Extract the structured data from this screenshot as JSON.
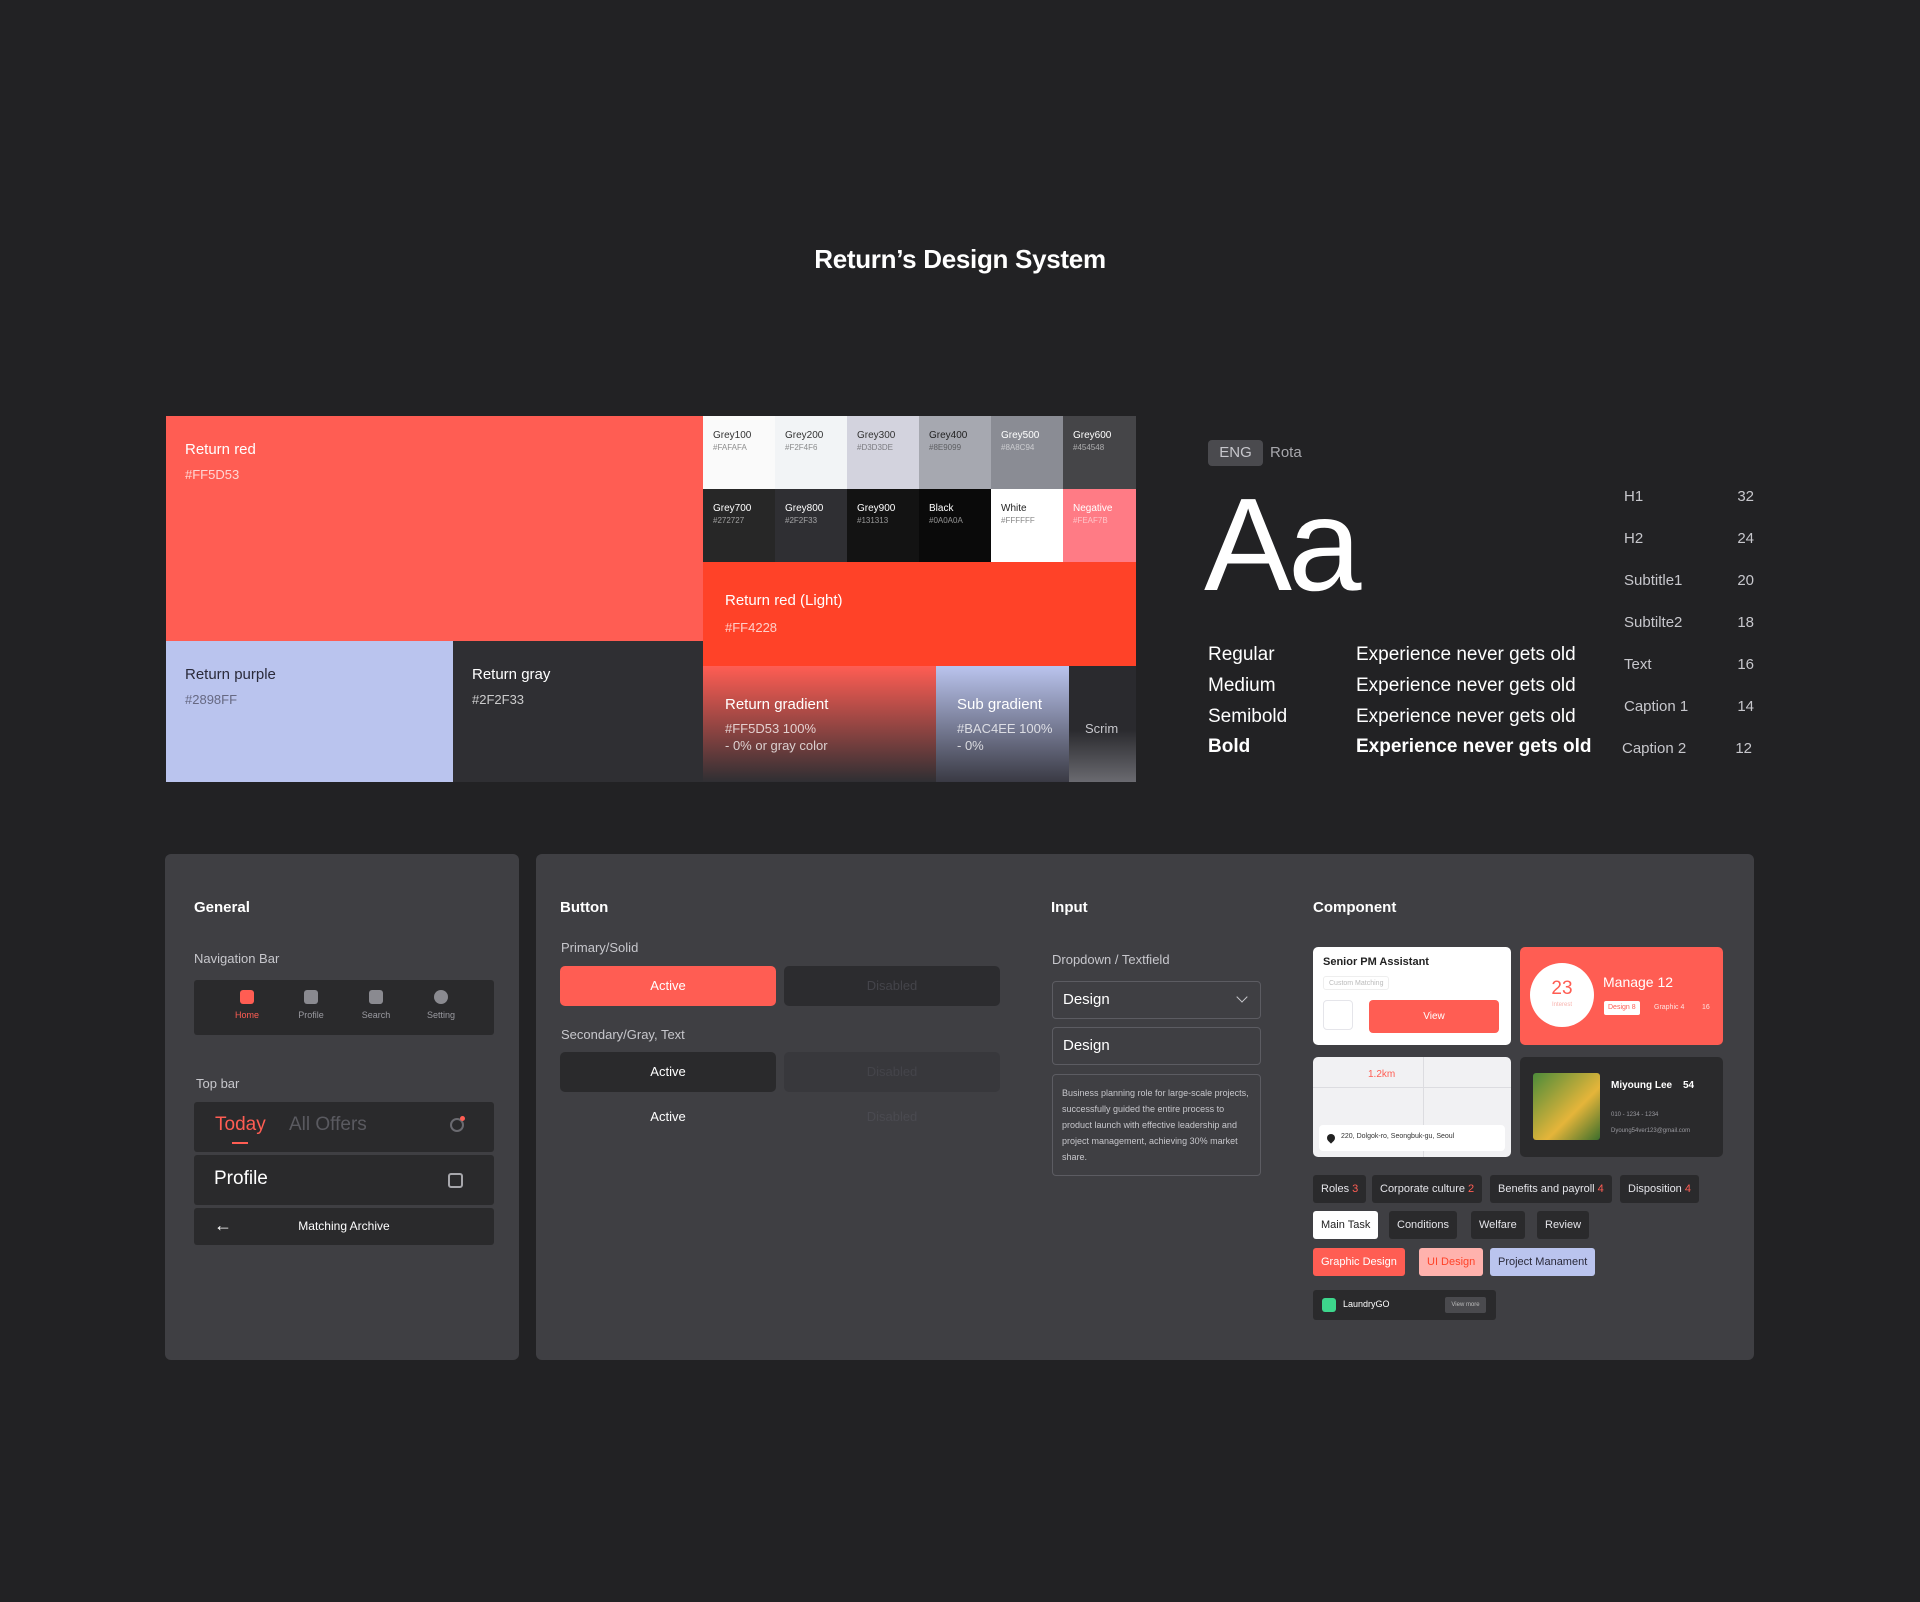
{
  "title": "Return’s Design System",
  "palette": {
    "return_red": {
      "name": "Return red",
      "hex": "#FF5D53"
    },
    "return_purple": {
      "name": "Return purple",
      "hex": "#2898FF"
    },
    "return_gray": {
      "name": "Return gray",
      "hex": "#2F2F33"
    },
    "return_red_light": {
      "name": "Return red (Light)",
      "hex": "#FF4228"
    },
    "return_gradient": {
      "name": "Return gradient",
      "hex": "#FF5D53 100%",
      "note": "- 0% or gray color"
    },
    "sub_gradient": {
      "name": "Sub gradient",
      "hex": "#BAC4EE 100%",
      "note": "- 0%"
    },
    "scrim": {
      "name": "Scrim"
    },
    "greys": [
      {
        "name": "Grey100",
        "hex": "#FAFAFA"
      },
      {
        "name": "Grey200",
        "hex": "#F2F4F6"
      },
      {
        "name": "Grey300",
        "hex": "#D3D3DE"
      },
      {
        "name": "Grey400",
        "hex": "#8E9099"
      },
      {
        "name": "Grey500",
        "hex": "#8A8C94"
      },
      {
        "name": "Grey600",
        "hex": "#454548"
      },
      {
        "name": "Grey700",
        "hex": "#272727"
      },
      {
        "name": "Grey800",
        "hex": "#2F2F33"
      },
      {
        "name": "Grey900",
        "hex": "#131313"
      },
      {
        "name": "Black",
        "hex": "#0A0A0A"
      },
      {
        "name": "White",
        "hex": "#FFFFFF"
      },
      {
        "name": "Negative",
        "hex": "#FEAF7B"
      }
    ]
  },
  "typography": {
    "lang": "ENG",
    "font": "Rota",
    "sample": "Aa",
    "weights": [
      "Regular",
      "Medium",
      "Semibold",
      "Bold"
    ],
    "sentence": "Experience never gets old",
    "scale": [
      {
        "name": "H1",
        "size": "32"
      },
      {
        "name": "H2",
        "size": "24"
      },
      {
        "name": "Subtitle1",
        "size": "20"
      },
      {
        "name": "Subtilte2",
        "size": "18"
      },
      {
        "name": "Text",
        "size": "16"
      },
      {
        "name": "Caption 1",
        "size": "14"
      },
      {
        "name": "Caption 2",
        "size": "12"
      }
    ]
  },
  "general": {
    "heading": "General",
    "nav_label": "Navigation Bar",
    "nav": [
      {
        "label": "Home",
        "icon": "home-icon"
      },
      {
        "label": "Profile",
        "icon": "profile-icon"
      },
      {
        "label": "Search",
        "icon": "search-icon"
      },
      {
        "label": "Setting",
        "icon": "gear-icon"
      }
    ],
    "topbar_label": "Top bar",
    "tab_today": "Today",
    "tab_offers": "All Offers",
    "profile": "Profile",
    "matching": "Matching Archive"
  },
  "button": {
    "heading": "Button",
    "primary_label": "Primary/Solid",
    "secondary_label": "Secondary/Gray, Text",
    "active": "Active",
    "disabled": "Disabled"
  },
  "input": {
    "heading": "Input",
    "label": "Dropdown / Textfield",
    "dropdown_value": "Design",
    "text_value": "Design",
    "textarea": "Business planning role for large-scale projects, successfully guided the entire process to product launch with effective leadership and project management, achieving 30% market share."
  },
  "component": {
    "heading": "Component",
    "job_title": "Senior PM Assistant",
    "job_tag": "Custom Matching",
    "view": "View",
    "manage_count": "23",
    "manage_sub": "Interest",
    "manage_title": "Manage 12",
    "manage_tags": [
      "Design 8",
      "Graphic 4",
      "16"
    ],
    "distance": "1.2km",
    "address": "220, Dolgok-ro, Seongbuk-gu, Seoul",
    "person_name": "Miyoung Lee",
    "person_age": "54",
    "person_phone": "010 - 1234 - 1234",
    "person_email": "Dyoung54ver123@gmail.com",
    "chips_row1": [
      {
        "label": "Roles",
        "count": "3"
      },
      {
        "label": "Corporate culture",
        "count": "2"
      },
      {
        "label": "Benefits and payroll",
        "count": "4"
      },
      {
        "label": "Disposition",
        "count": "4"
      }
    ],
    "chips_row2": [
      "Main Task",
      "Conditions",
      "Welfare",
      "Review"
    ],
    "chips_row3": [
      "Graphic Design",
      "UI Design",
      "Project Manament"
    ],
    "company": "LaundryGO",
    "view_more": "View more"
  }
}
